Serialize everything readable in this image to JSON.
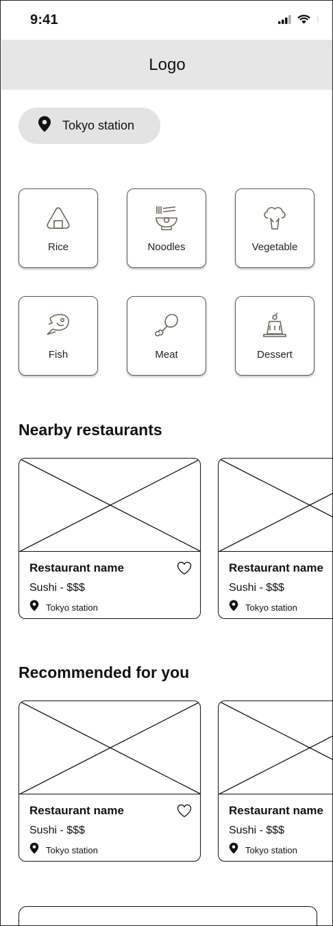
{
  "status_bar": {
    "time": "9:41",
    "icons": [
      "cellular-signal-icon",
      "wifi-icon",
      "battery-icon"
    ]
  },
  "header": {
    "logo": "Logo"
  },
  "location": {
    "label": "Tokyo station",
    "icon": "location-pin-icon"
  },
  "categories": [
    {
      "label": "Rice",
      "icon": "onigiri-icon"
    },
    {
      "label": "Noodles",
      "icon": "noodle-bowl-icon"
    },
    {
      "label": "Vegetable",
      "icon": "broccoli-icon"
    },
    {
      "label": "Fish",
      "icon": "fish-icon"
    },
    {
      "label": "Meat",
      "icon": "drumstick-icon"
    },
    {
      "label": "Dessert",
      "icon": "pudding-icon"
    }
  ],
  "sections": {
    "nearby": {
      "title": "Nearby restaurants",
      "cards": [
        {
          "name": "Restaurant name",
          "sub": "Sushi - $$$",
          "location": "Tokyo station"
        },
        {
          "name": "Restaurant name",
          "sub": "Sushi - $$$",
          "location": "Tokyo station"
        }
      ]
    },
    "recommended": {
      "title": "Recommended for you",
      "cards": [
        {
          "name": "Restaurant name",
          "sub": "Sushi - $$$",
          "location": "Tokyo station"
        },
        {
          "name": "Restaurant name",
          "sub": "Sushi - $$$",
          "location": "Tokyo station"
        }
      ]
    }
  },
  "colors": {
    "header_bg": "#e6e6e6",
    "chip_bg": "#e3e3e3",
    "category_border": "#5f5a4e",
    "icon_stroke": "#6b6656"
  }
}
